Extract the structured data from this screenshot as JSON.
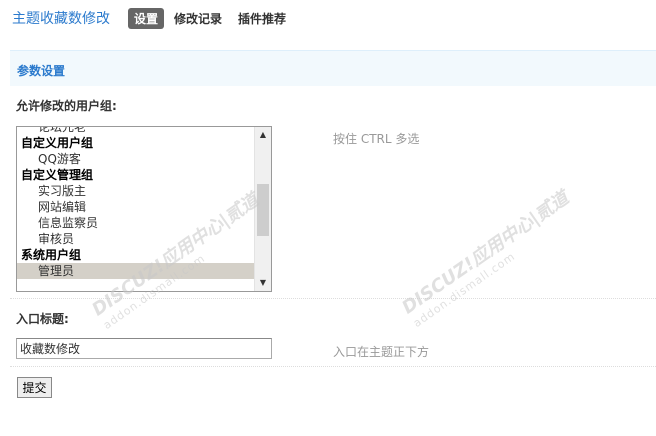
{
  "header": {
    "title": "主题收藏数修改",
    "tabs": [
      {
        "label": "设置",
        "active": true
      },
      {
        "label": "修改记录",
        "active": false
      },
      {
        "label": "插件推荐",
        "active": false
      }
    ]
  },
  "section": {
    "title": "参数设置"
  },
  "groups_field": {
    "label": "允许修改的用户组:",
    "hint": "按住 CTRL 多选",
    "items": [
      {
        "text": "论坛元老",
        "type": "option"
      },
      {
        "text": "自定义用户组",
        "type": "group"
      },
      {
        "text": "QQ游客",
        "type": "option"
      },
      {
        "text": "自定义管理组",
        "type": "group"
      },
      {
        "text": "实习版主",
        "type": "option"
      },
      {
        "text": "网站编辑",
        "type": "option"
      },
      {
        "text": "信息监察员",
        "type": "option"
      },
      {
        "text": "审核员",
        "type": "option"
      },
      {
        "text": "系统用户组",
        "type": "group"
      },
      {
        "text": "管理员",
        "type": "option",
        "selected": true
      }
    ]
  },
  "entry_field": {
    "label": "入口标题:",
    "value": "收藏数修改",
    "hint": "入口在主题正下方"
  },
  "submit_label": "提交",
  "watermark": {
    "brand": "DISCUZ!应用中心|贰道",
    "url": "addon.dismall.com"
  },
  "colors": {
    "accent": "#2b7acd",
    "section_bg": "#f2f9fd",
    "active_tab_bg": "#666666"
  }
}
